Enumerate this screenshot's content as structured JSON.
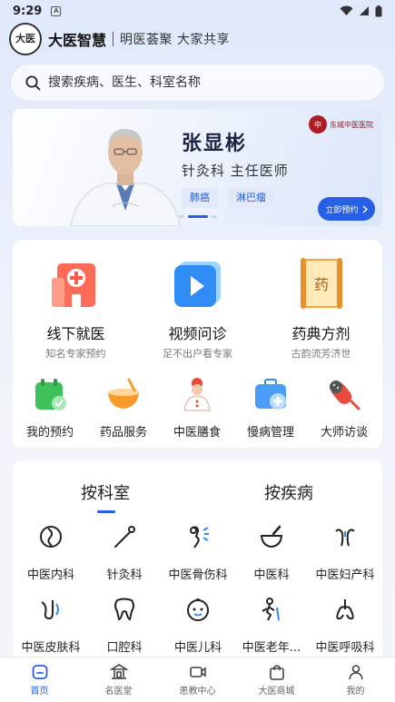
{
  "status_bar": {
    "time": "9:29"
  },
  "header": {
    "app_name": "大医智慧",
    "logo_text": "大医",
    "slogan": "明医荟聚 大家共享"
  },
  "search": {
    "placeholder": "搜索疾病、医生、科室名称"
  },
  "banner": {
    "doctor_name": "张显彬",
    "doctor_title": "针灸科 主任医师",
    "tags": [
      "肺癌",
      "淋巴瘤"
    ],
    "hospital_name": "东城中医医院",
    "book_button": "立即预约",
    "page_index": 2,
    "page_count": 3
  },
  "services": {
    "primary": [
      {
        "title": "线下就医",
        "subtitle": "知名专家预约",
        "icon": "hospital-icon"
      },
      {
        "title": "视频问诊",
        "subtitle": "足不出户看专家",
        "icon": "video-play-icon"
      },
      {
        "title": "药典方剂",
        "subtitle": "古韵流芳济世",
        "icon": "scroll-icon",
        "icon_text": "药"
      }
    ],
    "secondary": [
      {
        "label": "我的预约",
        "icon": "calendar-check-icon"
      },
      {
        "label": "药品服务",
        "icon": "medicine-bowl-icon"
      },
      {
        "label": "中医膳食",
        "icon": "chef-icon"
      },
      {
        "label": "慢病管理",
        "icon": "medkit-icon"
      },
      {
        "label": "大师访谈",
        "icon": "microphone-icon"
      }
    ]
  },
  "departments": {
    "tabs": [
      "按科室",
      "按疾病"
    ],
    "active_tab": 0,
    "items": [
      {
        "label": "中医内科",
        "icon": "stomach-icon"
      },
      {
        "label": "针灸科",
        "icon": "needle-icon"
      },
      {
        "label": "中医骨伤科",
        "icon": "bone-icon"
      },
      {
        "label": "中医科",
        "icon": "mortar-icon"
      },
      {
        "label": "中医妇产科",
        "icon": "uterus-icon"
      },
      {
        "label": "中医皮肤科",
        "icon": "skin-icon"
      },
      {
        "label": "口腔科",
        "icon": "tooth-icon"
      },
      {
        "label": "中医儿科",
        "icon": "baby-icon"
      },
      {
        "label": "中医老年...",
        "icon": "elder-icon"
      },
      {
        "label": "中医呼吸科",
        "icon": "lungs-icon"
      }
    ]
  },
  "bottom_nav": {
    "items": [
      {
        "label": "首页",
        "icon": "home-icon"
      },
      {
        "label": "名医堂",
        "icon": "hall-icon"
      },
      {
        "label": "患教中心",
        "icon": "video-camera-icon"
      },
      {
        "label": "大医商城",
        "icon": "shopping-bag-icon"
      },
      {
        "label": "我的",
        "icon": "user-icon"
      }
    ],
    "active": 0
  },
  "colors": {
    "accent": "#2660e6",
    "tag_bg": "#e2eafa",
    "hospital_red": "#b01c24"
  }
}
